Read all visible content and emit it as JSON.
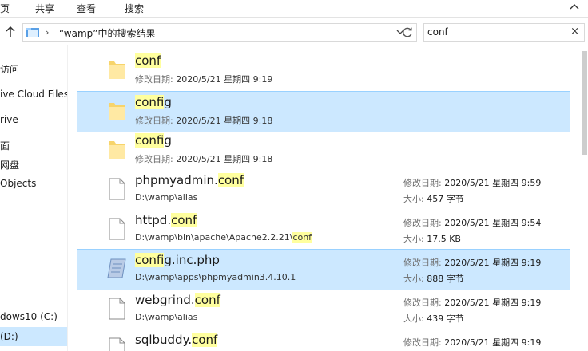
{
  "ribbon": {
    "tabs": [
      "主页",
      "共享",
      "查看",
      "搜索"
    ]
  },
  "address": {
    "path": "“wamp”中的搜索结果"
  },
  "search": {
    "value": "conf"
  },
  "nav": {
    "items": [
      "访问",
      "ive Cloud Files",
      "rive",
      "面",
      "网盘",
      "Objects",
      "dows10 (C:)",
      "(D:)"
    ]
  },
  "labels": {
    "modified": "修改日期:",
    "size": "大小:"
  },
  "results": [
    {
      "name_pre": "",
      "name_hl": "conf",
      "name_post": "",
      "date": "2020/5/21 星期四 9:19",
      "type": "folder"
    },
    {
      "name_pre": "",
      "name_hl": "conf",
      "name_post": "ig",
      "date": "2020/5/21 星期四 9:18",
      "type": "folder"
    },
    {
      "name_pre": "",
      "name_hl": "conf",
      "name_post": "ig",
      "date": "2020/5/21 星期四 9:18",
      "type": "folder"
    },
    {
      "name_pre": "phpmyadmin.",
      "name_hl": "conf",
      "name_post": "",
      "path_pre": "D:\\wamp\\alias",
      "path_hl": "",
      "date": "2020/5/21 星期四 9:59",
      "size": "457 字节",
      "type": "file"
    },
    {
      "name_pre": "httpd.",
      "name_hl": "conf",
      "name_post": "",
      "path_pre": "D:\\wamp\\bin\\apache\\Apache2.2.21\\",
      "path_hl": "conf",
      "date": "2020/5/21 星期四 9:54",
      "size": "17.5 KB",
      "type": "file"
    },
    {
      "name_pre": "",
      "name_hl": "conf",
      "name_post": "ig.inc.php",
      "path_pre": "D:\\wamp\\apps\\phpmyadmin3.4.10.1",
      "path_hl": "",
      "date": "2020/5/21 星期四 9:19",
      "size": "888 字节",
      "type": "php"
    },
    {
      "name_pre": "webgrind.",
      "name_hl": "conf",
      "name_post": "",
      "path_pre": "D:\\wamp\\alias",
      "path_hl": "",
      "date": "2020/5/21 星期四 9:19",
      "size": "439 字节",
      "type": "file"
    },
    {
      "name_pre": "sqlbuddy.",
      "name_hl": "conf",
      "name_post": "",
      "path_pre": "",
      "path_hl": "",
      "date": "2020/5/21 星期四 9:19",
      "size": "",
      "type": "file"
    }
  ]
}
